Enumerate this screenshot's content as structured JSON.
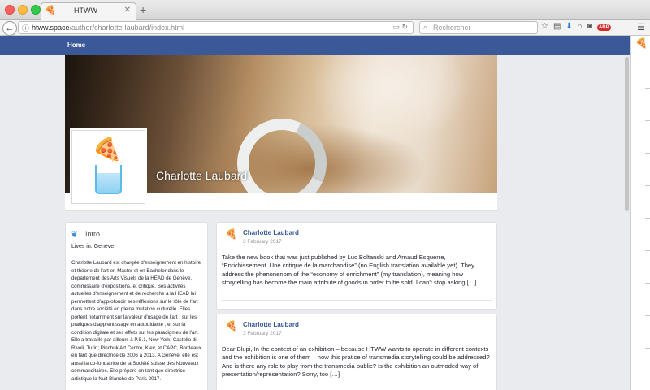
{
  "browser": {
    "tab_title": "HTWW",
    "tab_favicon": "🍕",
    "new_tab": "+",
    "url_host": "htww.space",
    "url_path": "/author/charlotte-laubard/index.html",
    "search_placeholder": "Rechercher",
    "abp_badge": "ABP"
  },
  "nav": {
    "home_label": "Home"
  },
  "profile": {
    "name": "Charlotte Laubard",
    "avatar_emoji": "🍕"
  },
  "intro": {
    "title": "Intro",
    "lives_in": "Lives in: Genève",
    "bio": "Charlotte Laubard est chargée d'enseignement en histoire et théorie de l'art en Master et en Bachelor dans le département des Arts Visuels de la HEAD de Genève, commissaire d'expositions, et critique. Ses activités actuelles d'enseignement et de recherche à la HEAD lui permettent d'approfondir ses réflexions sur le rôle de l'art dans notre société en pleine mutation culturelle. Elles portent notamment sur la valeur d'usage de l'art ; sur les pratiques d'apprentissage en autodidacte ; et sur la condition digitale et ses effets sur les paradigmes de l'art. Elle a travaillé par ailleurs à P.S.1, New York; Castello di Rivoli, Turin; Pinchuk Art Centre, Kiev, et CAPC, Bordeaux en tant que directrice de 2006 à 2013. A Genève, elle est aussi la co-fondatrice de la Société suisse des Nouveaux commanditaires. Elle prépare en tant que directrice artistique la Nuit Blanche de Paris 2017."
  },
  "posts": [
    {
      "author": "Charlotte Laubard",
      "date": "3 February 2017",
      "text": "Take the new book that was just published by Luc Boltanski and Arnaud Esquerre, “Enrichissement. Une critique de la marchandise” (no English translation available yet). They address the phenonenom of the “economy of enrichment” (my translation), meaning how storytelling has become the main attribute of goods in order to be sold. I can't stop asking […]"
    },
    {
      "author": "Charlotte Laubard",
      "date": "3 February 2017",
      "text": "Dear Blupi, In the context of an exhibition – because HTWW wants to operate in different contexts and the exhibition is one of them – how this pratice of transmedia storytelling could be addressed? And is there any role to play from the transmedia public? Is the exhibition an outmoded way of presentation/representation? Sorry, too […]"
    }
  ]
}
